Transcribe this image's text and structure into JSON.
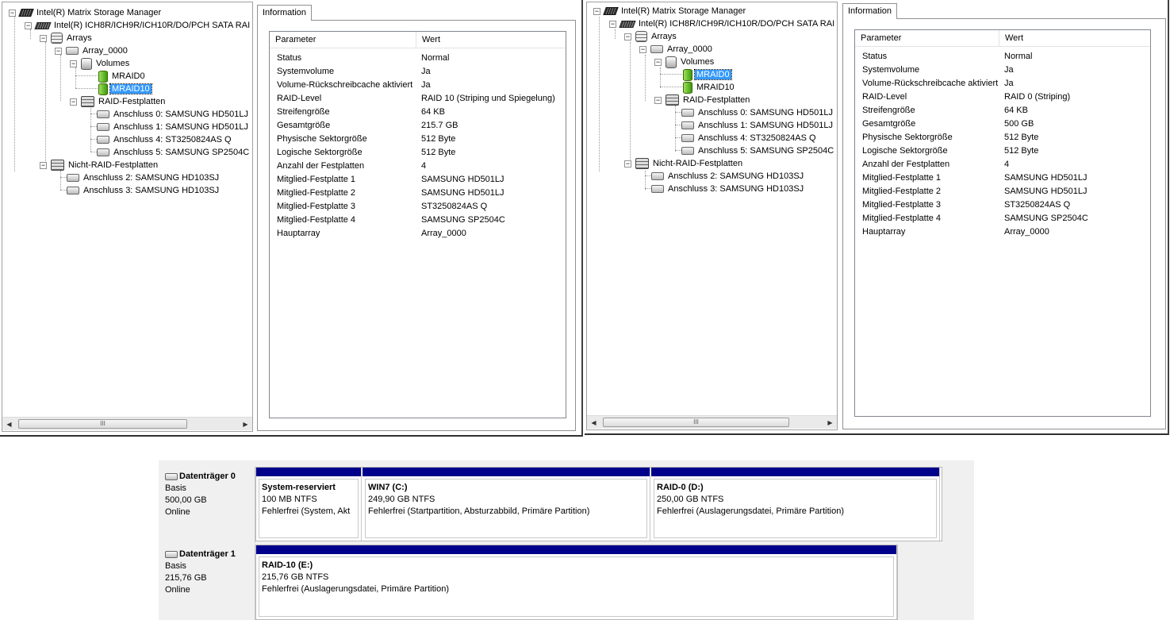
{
  "panels": [
    {
      "tree": {
        "root": "Intel(R) Matrix Storage Manager",
        "controller": "Intel(R) ICH8R/ICH9R/ICH10R/DO/PCH SATA RAI",
        "arrays": "Arrays",
        "array": "Array_0000",
        "volumes": "Volumes",
        "vol1": "MRAID0",
        "vol2": "MRAID10",
        "selected": "vol2",
        "raid_disks": "RAID-Festplatten",
        "d0": "Anschluss 0: SAMSUNG HD501LJ",
        "d1": "Anschluss 1: SAMSUNG HD501LJ",
        "d4": "Anschluss 4: ST3250824AS  Q",
        "d5": "Anschluss 5: SAMSUNG SP2504C",
        "nonraid": "Nicht-RAID-Festplatten",
        "n2": "Anschluss 2: SAMSUNG HD103SJ",
        "n3": "Anschluss 3: SAMSUNG HD103SJ",
        "scroll_grip": "III"
      },
      "tab": "Information",
      "headers": [
        "Parameter",
        "Wert"
      ],
      "rows": [
        [
          "Status",
          "Normal"
        ],
        [
          "Systemvolume",
          "Ja"
        ],
        [
          "Volume-Rückschreibcache aktiviert",
          "Ja"
        ],
        [
          "RAID-Level",
          "RAID 10 (Striping und Spiegelung)"
        ],
        [
          "Streifengröße",
          "64 KB"
        ],
        [
          "Gesamtgröße",
          "215.7 GB"
        ],
        [
          "Physische Sektorgröße",
          "512 Byte"
        ],
        [
          "Logische Sektorgröße",
          "512 Byte"
        ],
        [
          "Anzahl der Festplatten",
          "4"
        ],
        [
          "Mitglied-Festplatte 1",
          "SAMSUNG HD501LJ"
        ],
        [
          "Mitglied-Festplatte 2",
          "SAMSUNG HD501LJ"
        ],
        [
          "Mitglied-Festplatte 3",
          "ST3250824AS  Q"
        ],
        [
          "Mitglied-Festplatte 4",
          "SAMSUNG SP2504C"
        ],
        [
          "Hauptarray",
          "Array_0000"
        ]
      ]
    },
    {
      "tree": {
        "root": "Intel(R) Matrix Storage Manager",
        "controller": "Intel(R) ICH8R/ICH9R/ICH10R/DO/PCH SATA RAI",
        "arrays": "Arrays",
        "array": "Array_0000",
        "volumes": "Volumes",
        "vol1": "MRAID0",
        "vol2": "MRAID10",
        "selected": "vol1",
        "raid_disks": "RAID-Festplatten",
        "d0": "Anschluss 0: SAMSUNG HD501LJ",
        "d1": "Anschluss 1: SAMSUNG HD501LJ",
        "d4": "Anschluss 4: ST3250824AS  Q",
        "d5": "Anschluss 5: SAMSUNG SP2504C",
        "nonraid": "Nicht-RAID-Festplatten",
        "n2": "Anschluss 2: SAMSUNG HD103SJ",
        "n3": "Anschluss 3: SAMSUNG HD103SJ",
        "scroll_grip": "III"
      },
      "tab": "Information",
      "headers": [
        "Parameter",
        "Wert"
      ],
      "rows": [
        [
          "Status",
          "Normal"
        ],
        [
          "Systemvolume",
          "Ja"
        ],
        [
          "Volume-Rückschreibcache aktiviert",
          "Ja"
        ],
        [
          "RAID-Level",
          "RAID 0 (Striping)"
        ],
        [
          "Streifengröße",
          "64 KB"
        ],
        [
          "Gesamtgröße",
          "500 GB"
        ],
        [
          "Physische Sektorgröße",
          "512 Byte"
        ],
        [
          "Logische Sektorgröße",
          "512 Byte"
        ],
        [
          "Anzahl der Festplatten",
          "4"
        ],
        [
          "Mitglied-Festplatte 1",
          "SAMSUNG HD501LJ"
        ],
        [
          "Mitglied-Festplatte 2",
          "SAMSUNG HD501LJ"
        ],
        [
          "Mitglied-Festplatte 3",
          "ST3250824AS  Q"
        ],
        [
          "Mitglied-Festplatte 4",
          "SAMSUNG SP2504C"
        ],
        [
          "Hauptarray",
          "Array_0000"
        ]
      ]
    }
  ],
  "diskmgmt": {
    "disk0": {
      "name": "Datenträger 0",
      "type": "Basis",
      "size": "500,00 GB",
      "status": "Online",
      "partitions": [
        {
          "title": "System-reserviert",
          "size": "100 MB NTFS",
          "status": "Fehlerfrei (System, Akt"
        },
        {
          "title": "WIN7  (C:)",
          "size": "249,90 GB NTFS",
          "status": "Fehlerfrei (Startpartition, Absturzabbild, Primäre Partition)"
        },
        {
          "title": "RAID-0  (D:)",
          "size": "250,00 GB NTFS",
          "status": "Fehlerfrei (Auslagerungsdatei, Primäre Partition)"
        }
      ]
    },
    "disk1": {
      "name": "Datenträger 1",
      "type": "Basis",
      "size": "215,76 GB",
      "status": "Online",
      "partitions": [
        {
          "title": "RAID-10  (E:)",
          "size": "215,76 GB NTFS",
          "status": "Fehlerfrei (Auslagerungsdatei, Primäre Partition)"
        }
      ]
    },
    "partition_bar_color": "#00008b"
  }
}
